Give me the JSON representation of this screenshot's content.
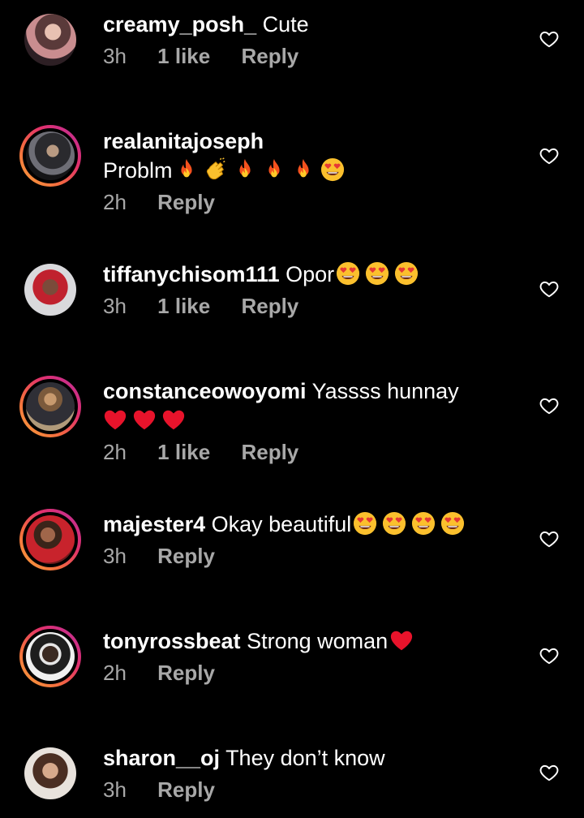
{
  "comments": [
    {
      "username": "creamy_posh_",
      "text": "Cute",
      "time": "3h",
      "likes": "1 like",
      "reply": "Reply"
    },
    {
      "username": "realanitajoseph",
      "text": "Problm",
      "time": "2h",
      "likes": "",
      "reply": "Reply"
    },
    {
      "username": "tiffanychisom111",
      "text": "Opor",
      "time": "3h",
      "likes": "1 like",
      "reply": "Reply"
    },
    {
      "username": "constanceowoyomi",
      "text": "Yassss hunnay",
      "time": "2h",
      "likes": "1 like",
      "reply": "Reply"
    },
    {
      "username": "majester4",
      "text": "Okay beautiful",
      "time": "3h",
      "likes": "",
      "reply": "Reply"
    },
    {
      "username": "tonyrossbeat",
      "text": "Strong woman",
      "time": "2h",
      "likes": "",
      "reply": "Reply"
    },
    {
      "username": "sharon__oj",
      "text": "They don’t know",
      "time": "3h",
      "likes": "",
      "reply": "Reply"
    }
  ],
  "colors": {
    "background": "#000000",
    "text": "#ffffff",
    "meta": "#a8a8a8",
    "story_ring_start": "#f9a53b",
    "story_ring_end": "#b92e9e"
  }
}
